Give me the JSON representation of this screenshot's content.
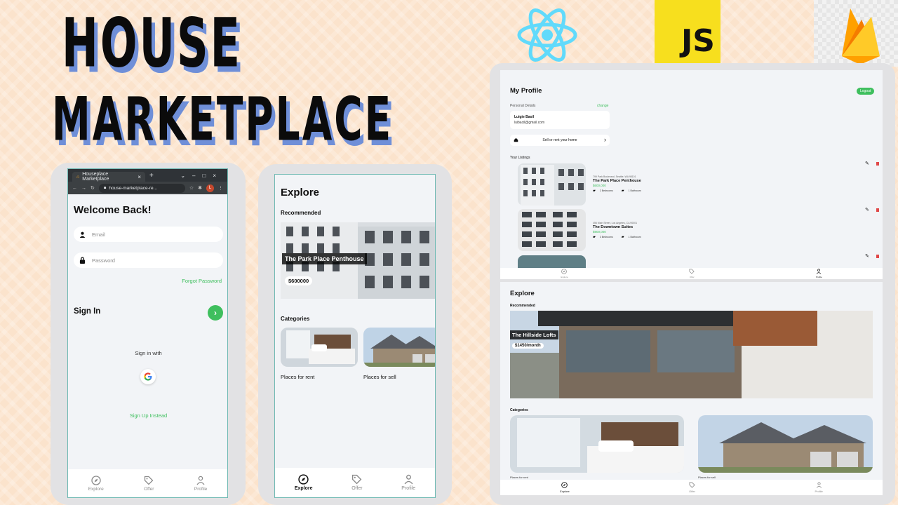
{
  "banner": {
    "title_line1": "HOUSE",
    "title_line2": "MARKETPLACE",
    "js_logo_text": "JS",
    "react_color": "#61dafb"
  },
  "colors": {
    "accent_green": "#3fbf5e",
    "delete_red": "#e04848"
  },
  "phone_signin": {
    "browser": {
      "tab_title": "Houseplace Marketplace",
      "url": "house-marketplace-re..."
    },
    "heading": "Welcome Back!",
    "email_placeholder": "Email",
    "password_placeholder": "Password",
    "forgot_password": "Forgot Password",
    "sign_in_label": "Sign In",
    "sign_in_with": "Sign in with",
    "sign_up_instead": "Sign Up Instead",
    "nav": {
      "explore": "Explore",
      "offer": "Offer",
      "profile": "Profile"
    }
  },
  "phone_explore": {
    "heading": "Explore",
    "recommended": "Recommended",
    "slide": {
      "title": "The Park Place Penthouse",
      "price": "$600000"
    },
    "categories_heading": "Categories",
    "categories": [
      "Places for rent",
      "Places for sell"
    ],
    "nav": {
      "explore": "Explore",
      "offer": "Offer",
      "profile": "Profile"
    }
  },
  "desktop_profile": {
    "heading": "My Profile",
    "logout": "Logout",
    "personal_details": "Personal Details",
    "change": "change",
    "name": "Luigie Basil",
    "email": "luibacil@gmail.com",
    "sell_rent": "Sell or rent your home",
    "your_listings": "Your Listings",
    "listings": [
      {
        "address": "799 Park Boulevard, Seattle, WA 98101",
        "name": "The Park Place Penthouse",
        "price": "$600,000",
        "bedrooms": "2 Bedrooms",
        "bathrooms": "1 Bathroom"
      },
      {
        "address": "456 Main Street, Los Angeles, CA 90001",
        "name": "The Downtown Suites",
        "price": "$900,000",
        "bedrooms": "3 Bedrooms",
        "bathrooms": "1 Bathroom"
      }
    ],
    "nav": {
      "explore": "Explore",
      "offer": "Offer",
      "profile": "Profile"
    }
  },
  "desktop_explore": {
    "heading": "Explore",
    "recommended": "Recommended",
    "slide": {
      "title": "The Hillside Lofts",
      "price": "$1450/month"
    },
    "categories_heading": "Categories",
    "categories": [
      "Places for rent",
      "Places for sell"
    ],
    "nav": {
      "explore": "Explore",
      "offer": "Offer",
      "profile": "Profile"
    }
  }
}
